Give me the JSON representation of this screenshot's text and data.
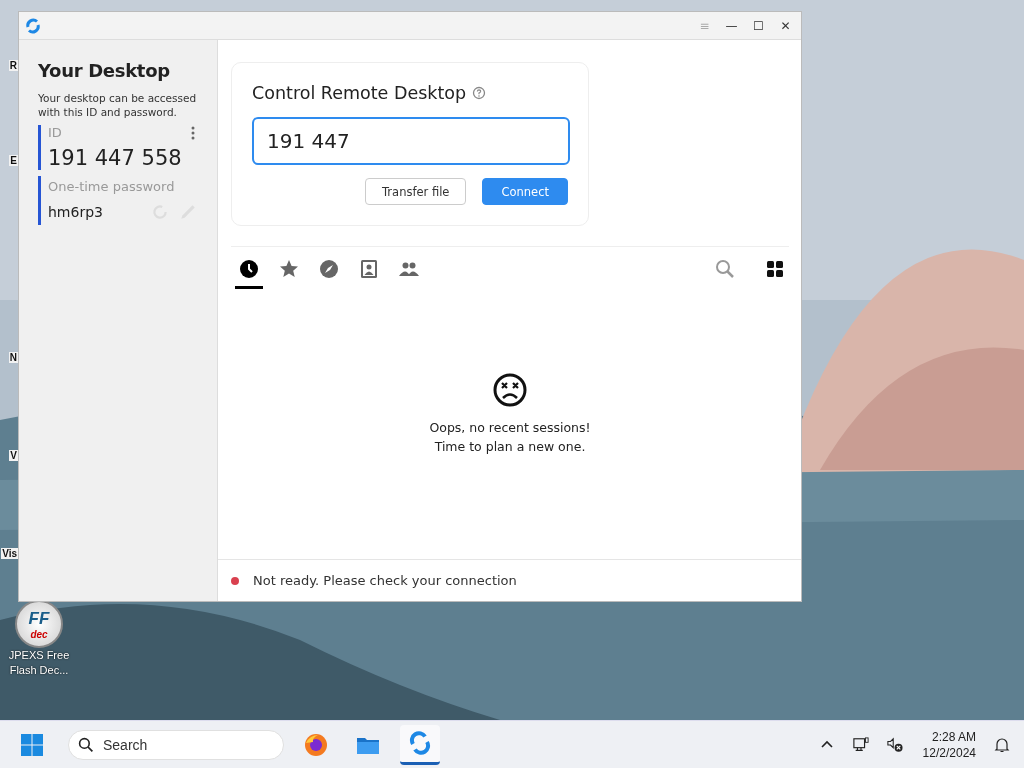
{
  "desktop": {
    "kind": "picture",
    "icon_fragments": [
      "R",
      "E",
      "N",
      "V",
      "Vis"
    ],
    "shortcut": {
      "icon_text": "FF",
      "icon_sub": "dec",
      "label": "JPEXS Free Flash Dec..."
    }
  },
  "window": {
    "controls": [
      "≡",
      "—",
      "☐",
      "✕"
    ]
  },
  "sidebar": {
    "title": "Your Desktop",
    "description": "Your desktop can be accessed with this ID and password.",
    "id_label": "ID",
    "id_value": "191 447 558",
    "password_label": "One-time password",
    "password_value": "hm6rp3"
  },
  "connect_card": {
    "title": "Control Remote Desktop",
    "input_value": "191 447",
    "buttons": [
      {
        "label": "Transfer file",
        "kind": "secondary"
      },
      {
        "label": "Connect",
        "kind": "primary"
      }
    ]
  },
  "tabs": [
    {
      "kind": "recent",
      "selected": true
    },
    {
      "kind": "favorites",
      "selected": false
    },
    {
      "kind": "discovered",
      "selected": false
    },
    {
      "kind": "address_book",
      "selected": false
    },
    {
      "kind": "group",
      "selected": false
    }
  ],
  "empty_state": {
    "lines": [
      "Oops, no recent sessions!",
      "Time to plan a new one."
    ]
  },
  "status_bar": {
    "text": "Not ready. Please check your connection",
    "color": "#d9404f"
  },
  "taskbar": {
    "search_placeholder": "Search",
    "apps": [
      {
        "kind": "firefox",
        "selected": false
      },
      {
        "kind": "files",
        "selected": false
      },
      {
        "kind": "rustdesk",
        "selected": true
      }
    ],
    "time": "2:28 AM",
    "date": "12/2/2024"
  }
}
